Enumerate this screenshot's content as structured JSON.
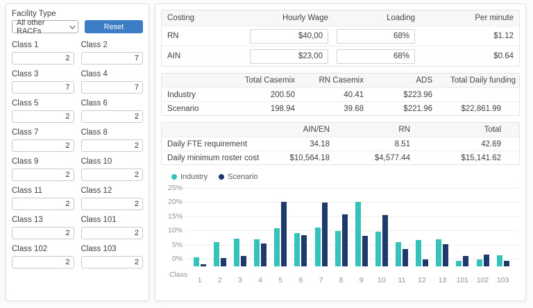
{
  "colors": {
    "accent_blue": "#3d7dc6",
    "industry_teal": "#35c2bb",
    "scenario_navy": "#1d3a6a"
  },
  "facility_panel": {
    "facility_type_label": "Facility Type",
    "facility_type_value": "All other RACFs",
    "reset_label": "Reset",
    "classes": [
      {
        "label": "Class 1",
        "value": "2"
      },
      {
        "label": "Class 2",
        "value": "7"
      },
      {
        "label": "Class 3",
        "value": "7"
      },
      {
        "label": "Class 4",
        "value": "7"
      },
      {
        "label": "Class 5",
        "value": "2"
      },
      {
        "label": "Class 6",
        "value": "2"
      },
      {
        "label": "Class 7",
        "value": "2"
      },
      {
        "label": "Class 8",
        "value": "2"
      },
      {
        "label": "Class 9",
        "value": "2"
      },
      {
        "label": "Class 10",
        "value": "2"
      },
      {
        "label": "Class 11",
        "value": "2"
      },
      {
        "label": "Class 12",
        "value": "2"
      },
      {
        "label": "Class 13",
        "value": "2"
      },
      {
        "label": "Class 101",
        "value": "2"
      },
      {
        "label": "Class 102",
        "value": "2"
      },
      {
        "label": "Class 103",
        "value": "2"
      }
    ]
  },
  "costing_table": {
    "headers": [
      "Costing",
      "Hourly Wage",
      "Loading",
      "Per minute"
    ],
    "rows": [
      {
        "label": "RN",
        "hourly_wage": "$40,00",
        "loading": "68%",
        "per_minute": "$1.12"
      },
      {
        "label": "AIN",
        "hourly_wage": "$23,00",
        "loading": "68%",
        "per_minute": "$0.64"
      }
    ]
  },
  "casemix_table": {
    "headers": [
      "",
      "Total Casemix",
      "RN Casemix",
      "ADS",
      "Total Daily funding"
    ],
    "rows": [
      {
        "label": "Industry",
        "total_casemix": "200.50",
        "rn_casemix": "40.41",
        "ads": "$223.96",
        "total_daily_funding": ""
      },
      {
        "label": "Scenario",
        "total_casemix": "198.94",
        "rn_casemix": "39.68",
        "ads": "$221.96",
        "total_daily_funding": "$22,861.99"
      }
    ]
  },
  "fte_table": {
    "headers": [
      "",
      "AIN/EN",
      "RN",
      "Total"
    ],
    "rows": [
      {
        "label": "Daily FTE requirement",
        "ain_en": "34.18",
        "rn": "8.51",
        "total": "42.69"
      },
      {
        "label": "Daily minimum roster cost",
        "ain_en": "$10,564.18",
        "rn": "$4,577.44",
        "total": "$15,141.62"
      }
    ]
  },
  "chart_data": {
    "type": "bar",
    "title": "",
    "xlabel": "Class",
    "ylabel": "",
    "grid": true,
    "legend_position": "top-left",
    "categories": [
      "1",
      "2",
      "3",
      "4",
      "5",
      "6",
      "7",
      "8",
      "9",
      "10",
      "11",
      "12",
      "13",
      "101",
      "102",
      "103"
    ],
    "series": [
      {
        "name": "Industry",
        "color": "#35c2bb",
        "values": [
          0.7,
          6.0,
          7.2,
          6.8,
          10.9,
          9.1,
          11.1,
          9.9,
          20.0,
          9.6,
          5.9,
          6.6,
          6.9,
          -0.6,
          -0.2,
          1.2
        ]
      },
      {
        "name": "Scenario",
        "color": "#1d3a6a",
        "values": [
          -1.9,
          0.4,
          1.1,
          5.4,
          20.2,
          8.3,
          19.8,
          15.6,
          8.2,
          15.4,
          3.5,
          -0.1,
          5.1,
          1.1,
          1.6,
          -0.6
        ]
      }
    ],
    "y_ticks": [
      "25%",
      "20%",
      "15%",
      "10%",
      "5%",
      "0%"
    ],
    "y_tick_values": [
      25,
      20,
      15,
      10,
      5,
      0
    ],
    "ylim": [
      0,
      25
    ]
  }
}
